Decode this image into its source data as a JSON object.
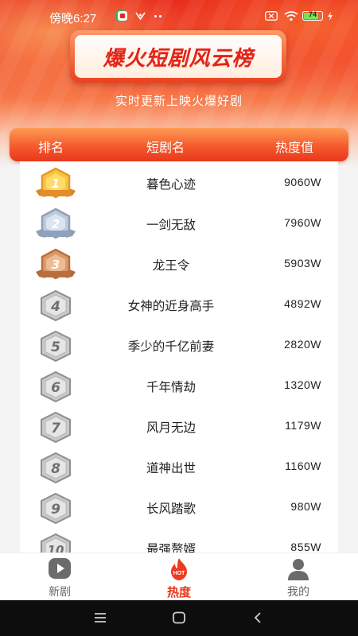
{
  "status_bar": {
    "time": "傍晚6:27",
    "battery_level": "74"
  },
  "header": {
    "title": "爆火短剧风云榜",
    "subtitle": "实时更新上映火爆好剧"
  },
  "table": {
    "columns": [
      "排名",
      "短剧名",
      "热度值"
    ],
    "rows": [
      {
        "rank": "1",
        "name": "暮色心迹",
        "heat": "9060W",
        "badge": "gold-medal-icon"
      },
      {
        "rank": "2",
        "name": "一剑无敌",
        "heat": "7960W",
        "badge": "silver-medal-icon"
      },
      {
        "rank": "3",
        "name": "龙王令",
        "heat": "5903W",
        "badge": "bronze-medal-icon"
      },
      {
        "rank": "4",
        "name": "女神的近身高手",
        "heat": "4892W",
        "badge": "rank-hexagon-icon"
      },
      {
        "rank": "5",
        "name": "季少的千亿前妻",
        "heat": "2820W",
        "badge": "rank-hexagon-icon"
      },
      {
        "rank": "6",
        "name": "千年情劫",
        "heat": "1320W",
        "badge": "rank-hexagon-icon"
      },
      {
        "rank": "7",
        "name": "风月无边",
        "heat": "1179W",
        "badge": "rank-hexagon-icon"
      },
      {
        "rank": "8",
        "name": "道神出世",
        "heat": "1160W",
        "badge": "rank-hexagon-icon"
      },
      {
        "rank": "9",
        "name": "长风踏歌",
        "heat": "980W",
        "badge": "rank-hexagon-icon"
      },
      {
        "rank": "10",
        "name": "最强赘婿",
        "heat": "855W",
        "badge": "rank-hexagon-icon"
      }
    ]
  },
  "tabbar": {
    "tabs": [
      {
        "label": "新剧",
        "icon": "play-icon"
      },
      {
        "label": "热度",
        "icon": "hot-flame-icon",
        "badge_text": "HOT"
      },
      {
        "label": "我的",
        "icon": "user-icon"
      }
    ],
    "active": "热度"
  },
  "colors": {
    "accent": "#e8361c",
    "header_red": "#e8281a",
    "gold": "#f2b134",
    "silver": "#a9b8cc",
    "bronze": "#c98657"
  }
}
